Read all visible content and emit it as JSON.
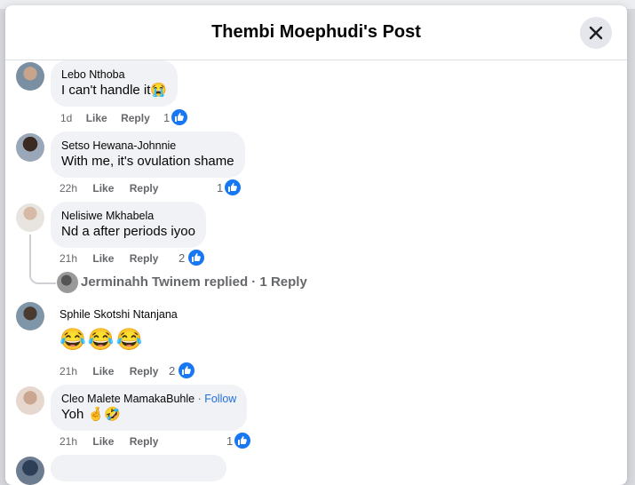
{
  "post_title": "Thembi Moephudi's Post",
  "comments": [
    {
      "author": "Lebo Nthoba",
      "text": "I can't handle it😭",
      "time": "1d",
      "like_label": "Like",
      "reply_label": "Reply",
      "reactions": "1"
    },
    {
      "author": "Setso Hewana-Johnnie",
      "text": "With me, it's ovulation shame",
      "time": "22h",
      "like_label": "Like",
      "reply_label": "Reply",
      "reactions": "1"
    },
    {
      "author": "Nelisiwe Mkhabela",
      "text": "Nd a after periods iyoo",
      "time": "21h",
      "like_label": "Like",
      "reply_label": "Reply",
      "reactions": "2",
      "replies_summary": "Jerminahh Twinem replied · 1 Reply"
    },
    {
      "author": "Sphile Skotshi Ntanjana",
      "text": "😂😂😂",
      "time": "21h",
      "like_label": "Like",
      "reply_label": "Reply",
      "reactions": "2"
    },
    {
      "author": "Cleo Malete MamakaBuhle",
      "separator": "·",
      "follow_label": "Follow",
      "text": "Yoh 🤞🤣",
      "time": "21h",
      "like_label": "Like",
      "reply_label": "Reply",
      "reactions": "1"
    }
  ],
  "icons": {
    "close": "close-icon",
    "like_badge": "thumbs-up-icon"
  },
  "colors": {
    "accent": "#1877f2",
    "bubble": "#f0f2f5",
    "follow": "#216fdb",
    "muted": "#65676b"
  }
}
